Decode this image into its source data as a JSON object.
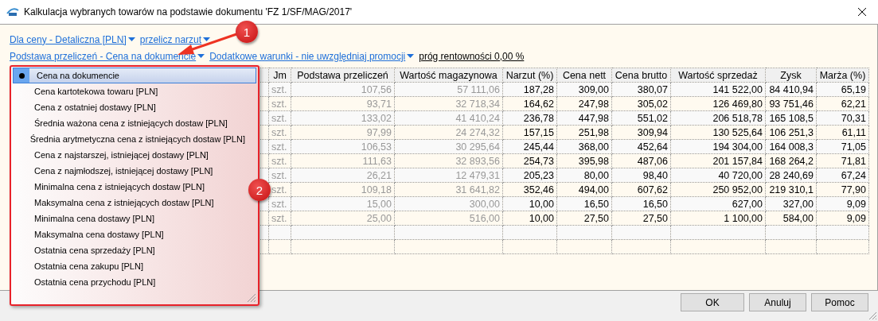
{
  "window": {
    "title": "Kalkulacja wybranych towarów na podstawie dokumentu 'FZ 1/SF/MAG/2017'"
  },
  "options_rows": [
    [
      {
        "kind": "dropdown",
        "label": "Dla ceny - Detaliczna [PLN]"
      },
      {
        "kind": "dropdown",
        "label": "przelicz narzut"
      }
    ],
    [
      {
        "kind": "dropdown",
        "label": "Podstawa przeliczeń - Cena na dokumencie"
      },
      {
        "kind": "dropdown",
        "label": "Dodatkowe warunki - nie uwzględniaj promocji"
      },
      {
        "kind": "plain",
        "label": "próg rentowności 0,00 %"
      }
    ]
  ],
  "table": {
    "columns": [
      {
        "label": "Jm",
        "muted": true
      },
      {
        "label": "Podstawa przeliczeń",
        "muted": true
      },
      {
        "label": "Wartość magazynowa",
        "muted": true
      },
      {
        "label": "Narzut (%)",
        "muted": false
      },
      {
        "label": "Cena nett",
        "muted": false
      },
      {
        "label": "Cena brutto",
        "muted": false
      },
      {
        "label": "Wartość sprzedaż",
        "muted": false
      },
      {
        "label": "Zysk",
        "muted": false
      },
      {
        "label": "Marża (%)",
        "muted": false
      }
    ],
    "rows": [
      [
        "szt.",
        "107,56",
        "57 111,06",
        "187,28",
        "309,00",
        "380,07",
        "141 522,00",
        "84 410,94",
        "65,19"
      ],
      [
        "szt.",
        "93,71",
        "32 718,34",
        "164,62",
        "247,98",
        "305,02",
        "126 469,80",
        "93 751,46",
        "62,21"
      ],
      [
        "szt.",
        "133,02",
        "41 410,24",
        "236,78",
        "447,98",
        "551,02",
        "206 518,78",
        "165 108,5",
        "70,31"
      ],
      [
        "szt.",
        "97,99",
        "24 274,32",
        "157,15",
        "251,98",
        "309,94",
        "130 525,64",
        "106 251,3",
        "61,11"
      ],
      [
        "szt.",
        "106,53",
        "30 295,64",
        "245,44",
        "368,00",
        "452,64",
        "194 304,00",
        "164 008,3",
        "71,05"
      ],
      [
        "szt.",
        "111,63",
        "32 893,56",
        "254,73",
        "395,98",
        "487,06",
        "201 157,84",
        "168 264,2",
        "71,81"
      ],
      [
        "szt.",
        "26,21",
        "12 479,31",
        "205,23",
        "80,00",
        "98,40",
        "40 720,00",
        "28 240,69",
        "67,24"
      ],
      [
        "szt.",
        "109,18",
        "31 641,82",
        "352,46",
        "494,00",
        "607,62",
        "250 952,00",
        "219 310,1",
        "77,90"
      ],
      [
        "szt.",
        "15,00",
        "300,00",
        "10,00",
        "16,50",
        "16,50",
        "627,00",
        "327,00",
        "9,09"
      ],
      [
        "szt.",
        "25,00",
        "516,00",
        "10,00",
        "27,50",
        "27,50",
        "1 100,00",
        "584,00",
        "9,09"
      ]
    ]
  },
  "dropdown_menu": {
    "items": [
      {
        "label": "Cena na dokumencie",
        "selected": true
      },
      {
        "label": "Cena kartotekowa towaru [PLN]",
        "selected": false
      },
      {
        "label": "Cena z ostatniej dostawy [PLN]",
        "selected": false
      },
      {
        "label": "Średnia ważona cena z istniejących dostaw [PLN]",
        "selected": false
      },
      {
        "label": "Średnia arytmetyczna cena z istniejących dostaw [PLN]",
        "selected": false
      },
      {
        "label": "Cena z najstarszej, istniejącej dostawy [PLN]",
        "selected": false
      },
      {
        "label": "Cena z najmłodszej, istniejącej dostawy [PLN]",
        "selected": false
      },
      {
        "label": "Minimalna cena z istniejących dostaw [PLN]",
        "selected": false
      },
      {
        "label": "Maksymalna cena z istniejących dostaw [PLN]",
        "selected": false
      },
      {
        "label": "Minimalna cena dostawy [PLN]",
        "selected": false
      },
      {
        "label": "Maksymalna cena dostawy [PLN]",
        "selected": false
      },
      {
        "label": "Ostatnia cena sprzedaży [PLN]",
        "selected": false
      },
      {
        "label": "Ostatnia cena zakupu [PLN]",
        "selected": false
      },
      {
        "label": "Ostatnia cena przychodu [PLN]",
        "selected": false
      }
    ]
  },
  "callouts": [
    {
      "label": "1"
    },
    {
      "label": "2"
    }
  ],
  "buttons": [
    "OK",
    "Anuluj",
    "Pomoc"
  ]
}
